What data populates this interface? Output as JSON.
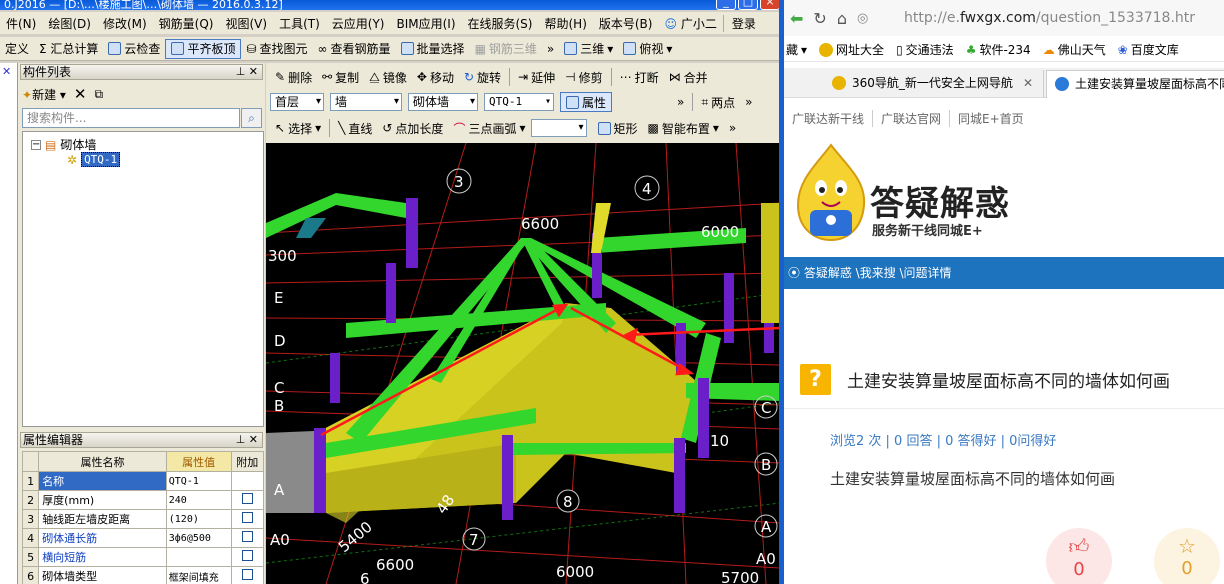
{
  "cad": {
    "title": "0.J2016 — [D:\\…\\楼施工图\\…\\砌体墙 — 2016.0.3.12]",
    "menu": [
      "件(N)",
      "绘图(D)",
      "修改(M)",
      "钢筋量(Q)",
      "视图(V)",
      "工具(T)",
      "云应用(Y)",
      "BIM应用(I)",
      "在线服务(S)",
      "帮助(H)",
      "版本号(B)",
      "广小二",
      "登录"
    ],
    "toolbar1": [
      "定义",
      "Σ 汇总计算",
      "云检查",
      "平齐板顶",
      "查找图元",
      "查看钢筋量",
      "批量选择",
      "钢筋三维",
      "三维",
      "俯视"
    ],
    "panel_title": "构件列表",
    "new_label": "新建",
    "search_placeholder": "搜索构件...",
    "tree_root": "砌体墙",
    "tree_child": "QTQ-1",
    "prop_title": "属性编辑器",
    "prop_headers": [
      "属性名称",
      "属性值",
      "附加"
    ],
    "props": [
      {
        "n": "1",
        "name": "名称",
        "value": "QTQ-1",
        "blue": false,
        "sel": true,
        "chk": false
      },
      {
        "n": "2",
        "name": "厚度(mm)",
        "value": "240",
        "blue": false,
        "sel": false,
        "chk": true
      },
      {
        "n": "3",
        "name": "轴线距左墙皮距离",
        "value": "(120)",
        "blue": false,
        "sel": false,
        "chk": true
      },
      {
        "n": "4",
        "name": "砌体通长筋",
        "value": "3ф6@500",
        "blue": true,
        "sel": false,
        "chk": true
      },
      {
        "n": "5",
        "name": "横向短筋",
        "value": "",
        "blue": true,
        "sel": false,
        "chk": true
      },
      {
        "n": "6",
        "name": "砌体墙类型",
        "value": "框架间填充",
        "blue": false,
        "sel": false,
        "chk": true
      }
    ],
    "edit_row": [
      "删除",
      "复制",
      "镜像",
      "移动",
      "旋转",
      "延伸",
      "修剪",
      "打断",
      "合并"
    ],
    "floor_row": {
      "floor": "首层",
      "type": "墙",
      "sub": "砌体墙",
      "item": "QTQ-1",
      "prop": "属性",
      "pts": "两点"
    },
    "draw_row": [
      "选择",
      "直线",
      "点加长度",
      "三点画弧",
      "矩形",
      "智能布置"
    ],
    "viewport_labels": [
      "3",
      "4",
      "6600",
      "6000",
      "300",
      "E",
      "D",
      "C",
      "B",
      "A",
      "A0",
      "5400",
      "6600",
      "6000",
      "5700",
      "7",
      "8",
      "48",
      "10",
      "B",
      "C",
      "A",
      "A0",
      "6"
    ]
  },
  "browser": {
    "url_prefix": "http://e.",
    "url_domain": "fwxgx.com",
    "url_path": "/question_1533718.htr",
    "bookmarks": [
      "藏",
      "网址大全",
      "交通违法",
      "软件-234",
      "佛山天气",
      "百度文库"
    ],
    "tab1": "360导航_新一代安全上网导航",
    "tab2": "土建安装算量坡屋面标高不同",
    "site_nav": [
      "广联达新干线",
      "广联达官网",
      "同城E+首页"
    ],
    "logo_title": "答疑解惑",
    "logo_sub": "服务新干线同城E+",
    "breadcrumb": "答疑解惑 \\我来搜 \\问题详情",
    "question_badge": "?",
    "question_title": "土建安装算量坡屋面标高不同的墙体如何画",
    "stats": "浏览2 次 | 0 回答 | 0 答得好 | 0问得好",
    "question_body": "土建安装算量坡屋面标高不同的墙体如何画",
    "like_count": "0",
    "fav_count": "0"
  },
  "colors": {
    "beam": "#32d62c",
    "column": "#6a1fc8",
    "slab": "#c9c31b",
    "grid_red": "#c8201c",
    "arrow": "#ff1a1a",
    "brand_blue": "#1e73be"
  }
}
